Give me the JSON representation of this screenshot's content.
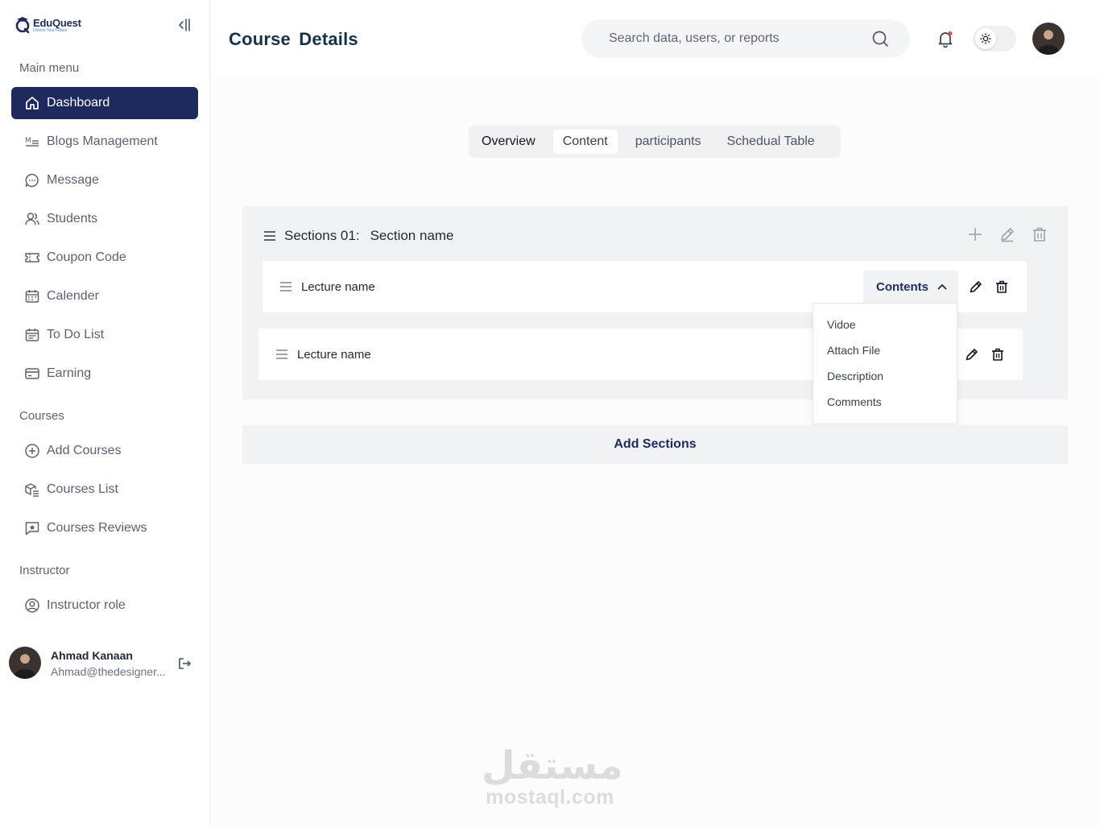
{
  "brand": {
    "name": "EduQuest",
    "tagline": "Unlock Your Future"
  },
  "sidebar": {
    "main_heading": "Main menu",
    "main_items": [
      {
        "label": "Dashboard",
        "icon": "home-icon",
        "active": true
      },
      {
        "label": "Blogs Management",
        "icon": "blogs-icon"
      },
      {
        "label": "Message",
        "icon": "message-icon"
      },
      {
        "label": "Students",
        "icon": "users-icon"
      },
      {
        "label": "Coupon Code",
        "icon": "ticket-icon"
      },
      {
        "label": "Calender",
        "icon": "calendar-icon"
      },
      {
        "label": "To Do List",
        "icon": "todo-icon"
      },
      {
        "label": "Earning",
        "icon": "card-icon"
      }
    ],
    "courses_heading": "Courses",
    "courses_items": [
      {
        "label": "Add Courses",
        "icon": "plus-circle-icon"
      },
      {
        "label": "Courses List",
        "icon": "courses-list-icon"
      },
      {
        "label": "Courses Reviews",
        "icon": "star-review-icon"
      }
    ],
    "instructor_heading": "Instructor",
    "instructor_items": [
      {
        "label": "Instructor role",
        "icon": "user-circle-icon"
      }
    ],
    "user": {
      "name": "Ahmad Kanaan",
      "email": "Ahmad@thedesigner..."
    }
  },
  "header": {
    "title": "Course  Details",
    "search_placeholder": "Search data, users, or reports"
  },
  "tabs": [
    {
      "label": "Overview"
    },
    {
      "label": "Content",
      "active": true
    },
    {
      "label": "participants"
    },
    {
      "label": "Schedual Table"
    }
  ],
  "section": {
    "label": "Sections 01:",
    "name": "Section name",
    "lectures": [
      {
        "name": "Lecture name"
      },
      {
        "name": "Lecture name"
      }
    ],
    "contents_button": "Contents",
    "dropdown_items": [
      "Vidoe",
      "Attach File",
      "Description",
      "Comments"
    ]
  },
  "add_sections_label": "Add Sections",
  "watermark": {
    "arabic": "مستقل",
    "latin": "mostaql.com"
  },
  "colors": {
    "accent": "#1e2a5e",
    "notification_dot": "#ef4444"
  }
}
